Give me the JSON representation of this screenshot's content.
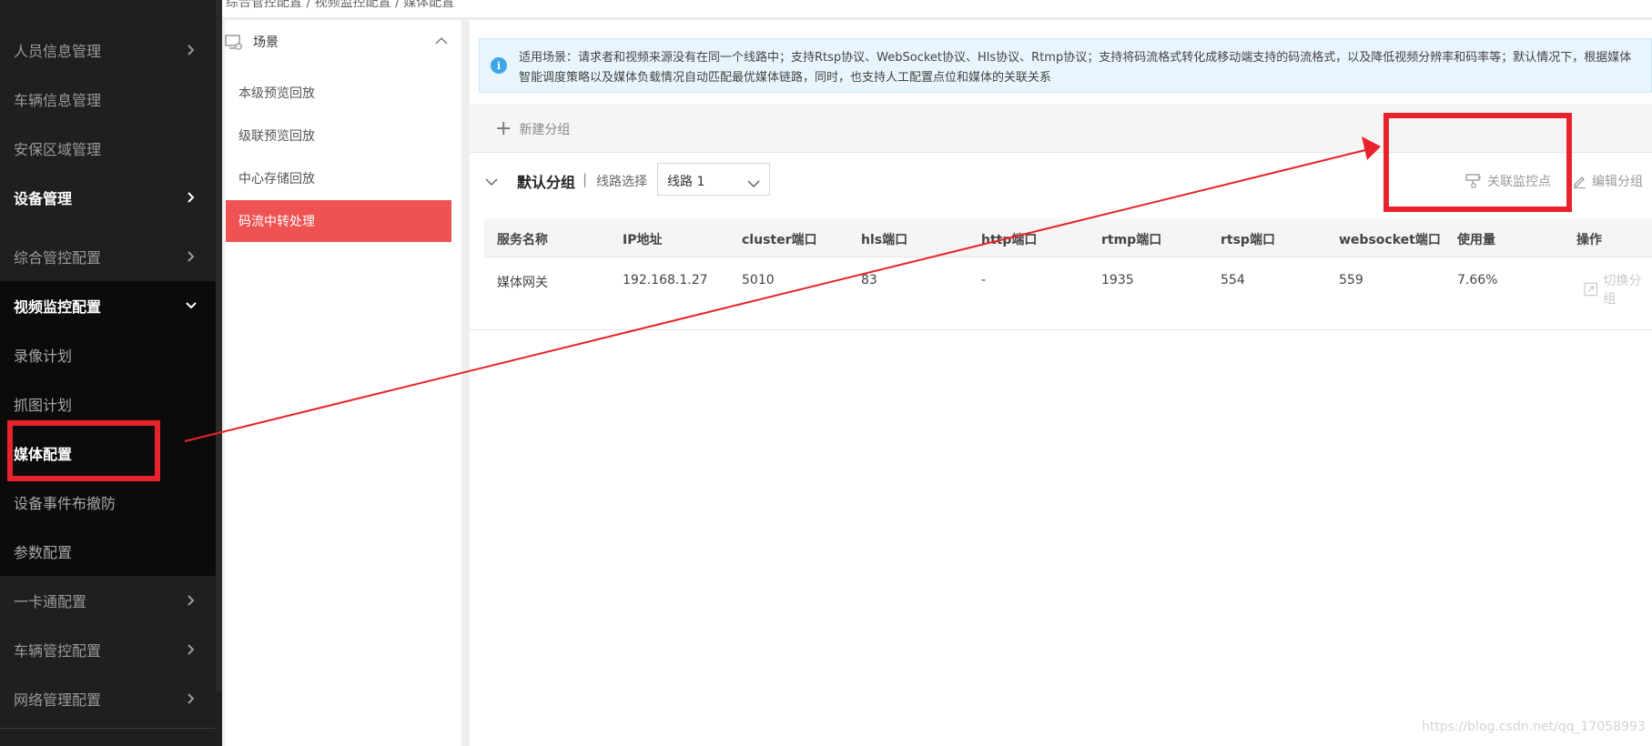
{
  "breadcrumb": "综合管控配置 / 视频监控配置 / 媒体配置",
  "sidebar": {
    "items": [
      {
        "label": "人员信息管理",
        "style": "normal",
        "chevron": "right"
      },
      {
        "label": "车辆信息管理",
        "style": "normal",
        "chevron": ""
      },
      {
        "label": "安保区域管理",
        "style": "normal",
        "chevron": ""
      },
      {
        "label": "设备管理",
        "style": "bold",
        "chevron": "right"
      },
      {
        "label": "综合管控配置",
        "style": "normal",
        "chevron": "right"
      },
      {
        "label": "视频监控配置",
        "style": "bold",
        "chevron": "down"
      },
      {
        "label": "录像计划",
        "style": "sub",
        "chevron": ""
      },
      {
        "label": "抓图计划",
        "style": "sub",
        "chevron": ""
      },
      {
        "label": "媒体配置",
        "style": "active",
        "chevron": ""
      },
      {
        "label": "设备事件布撤防",
        "style": "sub",
        "chevron": ""
      },
      {
        "label": "参数配置",
        "style": "sub",
        "chevron": ""
      },
      {
        "label": "一卡通配置",
        "style": "normal",
        "chevron": "right"
      },
      {
        "label": "车辆管控配置",
        "style": "normal",
        "chevron": "right"
      },
      {
        "label": "网络管理配置",
        "style": "normal",
        "chevron": "right"
      }
    ]
  },
  "scene": {
    "title": "场景",
    "icon": "scene-monitor-icon",
    "items": [
      "本级预览回放",
      "级联预览回放",
      "中心存储回放",
      "码流中转处理"
    ],
    "active_index": 3
  },
  "notice": {
    "icon": "info-icon",
    "line1": "适用场景：请求者和视频来源没有在同一个线路中；支持Rtsp协议、WebSocket协议、Hls协议、Rtmp协议；支持将码流格式转化成移动端支持的码流格式，以及降低视频分辨率和码率等；默认情况下，根据媒体",
    "line2": "智能调度策略以及媒体负载情况自动匹配最优媒体链路，同时，也支持人工配置点位和媒体的关联关系"
  },
  "toolbar": {
    "new_group": "新建分组"
  },
  "group": {
    "name": "默认分组",
    "separator": "|",
    "route_label": "线路选择",
    "route_value": "线路 1",
    "assoc_label": "关联监控点",
    "edit_label": "编辑分组"
  },
  "table": {
    "headers": [
      "服务名称",
      "IP地址",
      "cluster端口",
      "hls端口",
      "http端口",
      "rtmp端口",
      "rtsp端口",
      "websocket端口",
      "使用量",
      "操作"
    ],
    "rows": [
      {
        "cells": [
          "媒体网关",
          "192.168.1.27",
          "5010",
          "83",
          "-",
          "1935",
          "554",
          "559",
          "7.66%"
        ],
        "action": "切换分组"
      }
    ]
  },
  "watermark": "https://blog.csdn.net/qq_17058993",
  "annotation_color": "#e8232b",
  "active_color": "#ee5253"
}
